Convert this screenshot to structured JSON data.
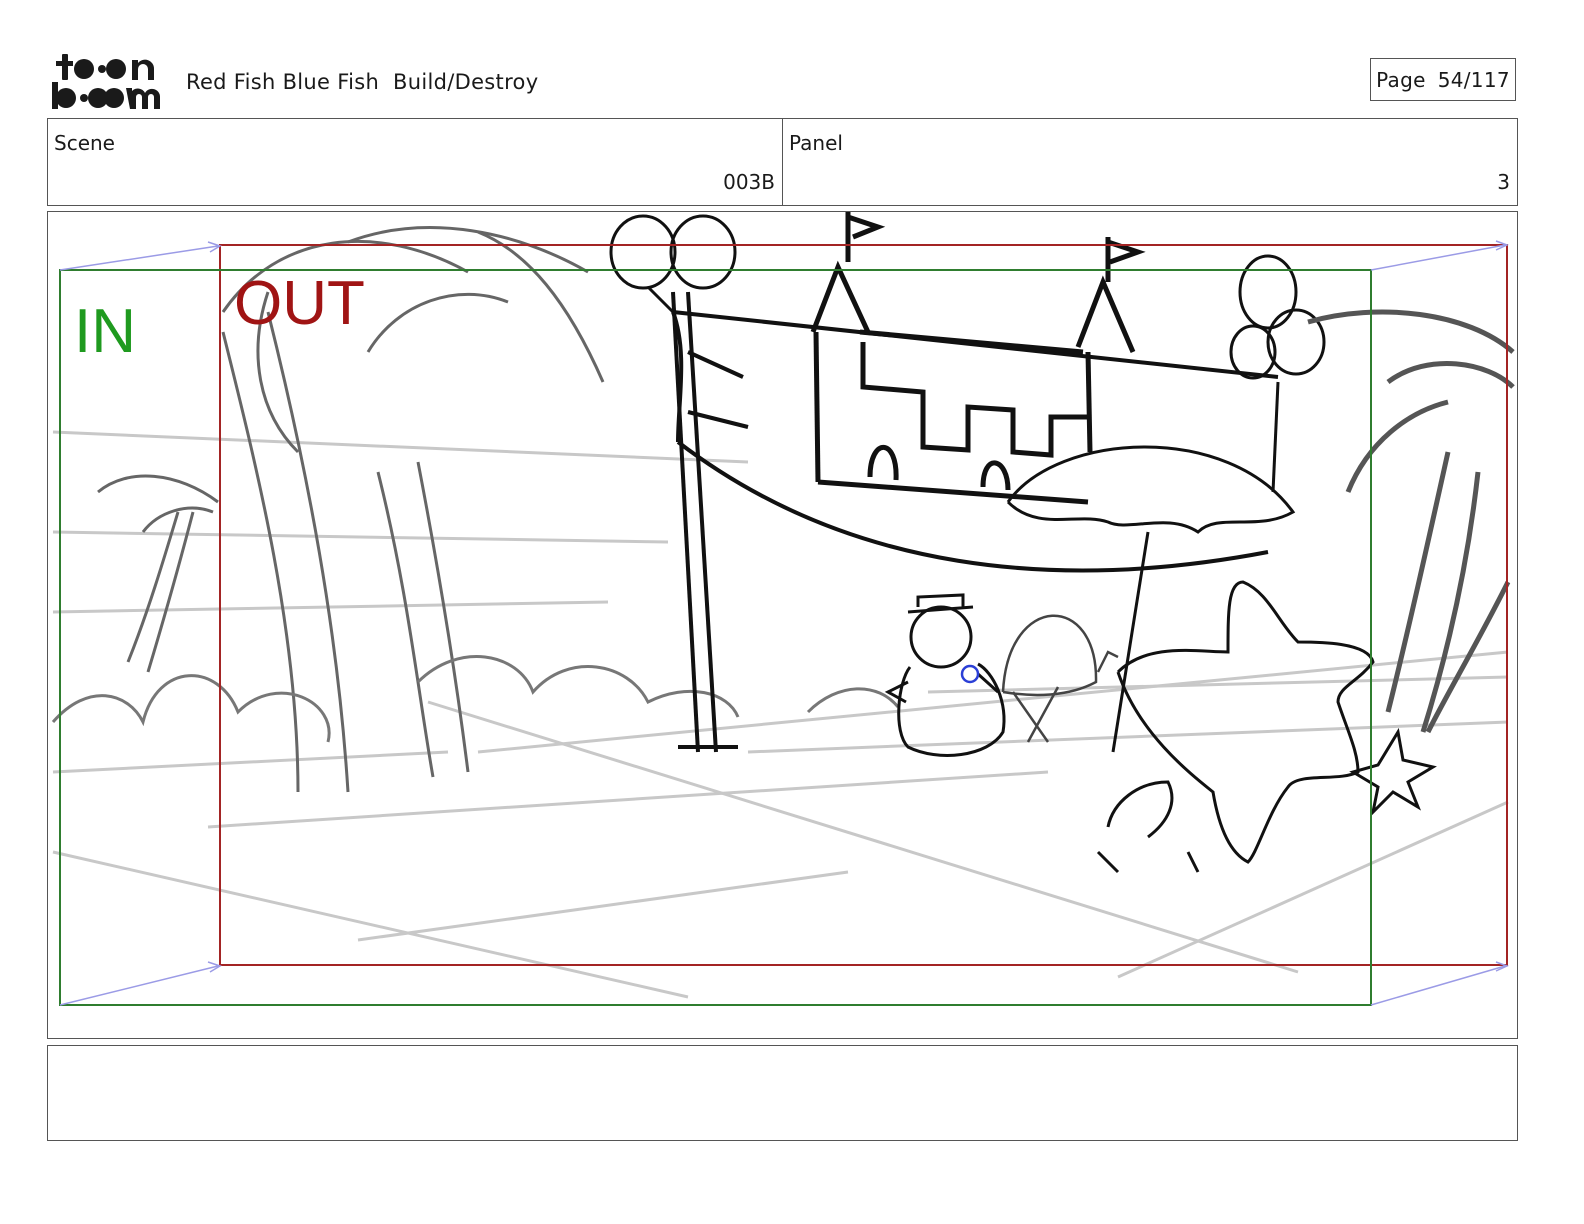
{
  "header": {
    "logo_alt": "toon boom",
    "title": "Red Fish Blue Fish  Build/Destroy",
    "page_label": "Page",
    "page_number": "54/117"
  },
  "info": {
    "scene_label": "Scene",
    "scene_value": "003B",
    "panel_label": "Panel",
    "panel_value": "3"
  },
  "frame": {
    "in_label": "IN",
    "out_label": "OUT",
    "in_color": "#1f9a1f",
    "out_color": "#a01414",
    "in_box_color": "#2f7d2f",
    "out_box_color": "#a32424",
    "camera_path_color": "#9b9be6"
  },
  "notes": {
    "text": ""
  }
}
